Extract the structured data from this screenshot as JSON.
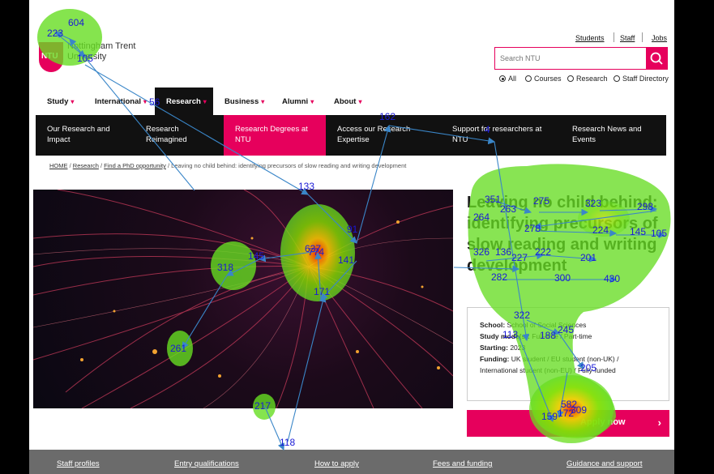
{
  "header": {
    "logo_text": "NTU",
    "uni_name_line1": "Nottingham Trent",
    "uni_name_line2": "University",
    "util_links": [
      "Students",
      "Staff",
      "Jobs"
    ],
    "search_placeholder": "Search NTU",
    "radio_options": [
      {
        "label": "All",
        "selected": true
      },
      {
        "label": "Courses",
        "selected": false
      },
      {
        "label": "Research",
        "selected": false
      },
      {
        "label": "Staff Directory",
        "selected": false
      }
    ]
  },
  "main_nav": {
    "items": [
      "Study",
      "International",
      "Research",
      "Business",
      "Alumni",
      "About"
    ],
    "active": "Research"
  },
  "sub_nav": {
    "items": [
      "Our Research and Impact",
      "Research Reimagined",
      "Research Degrees at NTU",
      "Access our Research Expertise",
      "Support for researchers at NTU",
      "Research News and Events"
    ],
    "active": "Research Degrees at NTU"
  },
  "breadcrumb": {
    "home": "HOME",
    "research": "Research",
    "phd": "Find a PhD opportunity",
    "current": "Leaving no child behind: identifying precursors of slow reading and writing development",
    "sep": "/"
  },
  "main": {
    "title": "Leaving no child behind: identifying precursors of slow reading and writing development",
    "info": {
      "school_label": "School:",
      "school_value": "School of Social Sciences",
      "study_label": "Study mode(s):",
      "study_value": "Full-time / Part-time",
      "starting_label": "Starting:",
      "starting_value": "2023",
      "funding_label": "Funding:",
      "funding_value": "UK student / EU student (non-UK) / International student (non-EU) / Fully-funded"
    },
    "apply_label": "Apply now",
    "apply_chevron": "›"
  },
  "footer": {
    "links": [
      "Staff profiles",
      "Entry qualifications",
      "How to apply",
      "Fees and funding",
      "Guidance and support"
    ]
  },
  "gaze": {
    "colors": {
      "arrow": "#4a9fe0",
      "label": "#1a1ad6",
      "heat_low": "#66dd22",
      "heat_mid": "#ffee00",
      "heat_high": "#ff3300"
    },
    "fixation_labels": [
      "604",
      "223",
      "105",
      "56",
      "162",
      "133",
      "91",
      "637",
      "774",
      "145",
      "318",
      "141",
      "171",
      "261",
      "217",
      "118",
      "351",
      "275",
      "323",
      "298",
      "264",
      "263",
      "278",
      "224",
      "145",
      "105",
      "326",
      "136",
      "227",
      "222",
      "201",
      "282",
      "300",
      "430",
      "322",
      "113",
      "188",
      "245",
      "205",
      "582",
      "159",
      "172",
      "309",
      "4"
    ]
  }
}
